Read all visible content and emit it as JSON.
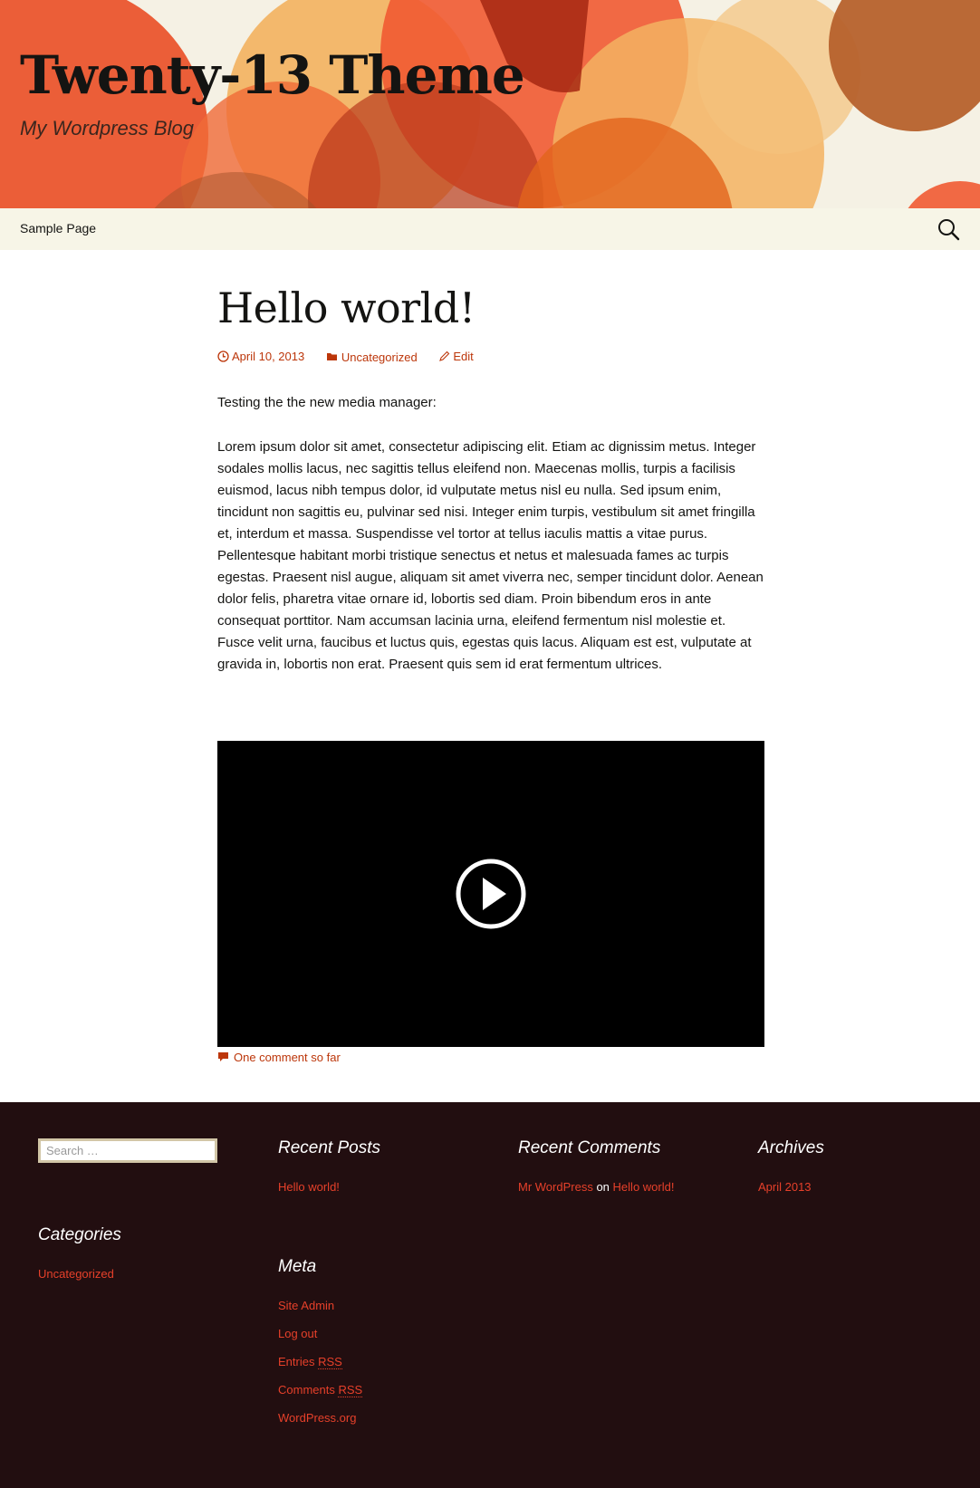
{
  "header": {
    "title": "Twenty-13 Theme",
    "description": "My Wordpress Blog"
  },
  "nav": {
    "items": [
      {
        "label": "Sample Page"
      }
    ],
    "search_icon": "search-icon"
  },
  "post": {
    "title": "Hello world!",
    "date": "April 10, 2013",
    "category": "Uncategorized",
    "edit": "Edit",
    "intro": "Testing the the new media manager:",
    "body": "Lorem ipsum dolor sit amet, consectetur adipiscing elit. Etiam ac dignissim metus. Integer sodales mollis lacus, nec sagittis tellus eleifend non. Maecenas mollis, turpis a facilisis euismod, lacus nibh tempus dolor, id vulputate metus nisl eu nulla. Sed ipsum enim, tincidunt non sagittis eu, pulvinar sed nisi. Integer enim turpis, vestibulum sit amet fringilla et, interdum et massa. Suspendisse vel tortor at tellus iaculis mattis a vitae purus. Pellentesque habitant morbi tristique senectus et netus et malesuada fames ac turpis egestas. Praesent nisl augue, aliquam sit amet viverra nec, semper tincidunt dolor. Aenean dolor felis, pharetra vitae ornare id, lobortis sed diam. Proin bibendum eros in ante consequat porttitor. Nam accumsan lacinia urna, eleifend fermentum nisl molestie et. Fusce velit urna, faucibus et luctus quis, egestas quis lacus. Aliquam est est, vulputate at gravida in, lobortis non erat. Praesent quis sem id erat fermentum ultrices.",
    "comments_link": "One comment so far",
    "icons": {
      "date": "clock-icon",
      "category": "folder-icon",
      "edit": "pencil-icon",
      "comments": "comment-icon",
      "video": "play-icon"
    }
  },
  "footer": {
    "search": {
      "placeholder": "Search …"
    },
    "recent_posts": {
      "title": "Recent Posts",
      "items": [
        "Hello world!"
      ]
    },
    "recent_comments": {
      "title": "Recent Comments",
      "author": "Mr WordPress",
      "on": "on",
      "post": "Hello world!"
    },
    "archives": {
      "title": "Archives",
      "items": [
        "April 2013"
      ]
    },
    "categories": {
      "title": "Categories",
      "items": [
        "Uncategorized"
      ]
    },
    "meta": {
      "title": "Meta",
      "site_admin": "Site Admin",
      "log_out": "Log out",
      "entries_prefix": "Entries",
      "comments_prefix": "Comments",
      "rss": "RSS",
      "wordpress_org": "WordPress.org"
    }
  },
  "colors": {
    "accent": "#bc360a",
    "footer_bg": "#220e10",
    "nav_bg": "#f7f5e7",
    "widget_link": "#e6402a"
  }
}
